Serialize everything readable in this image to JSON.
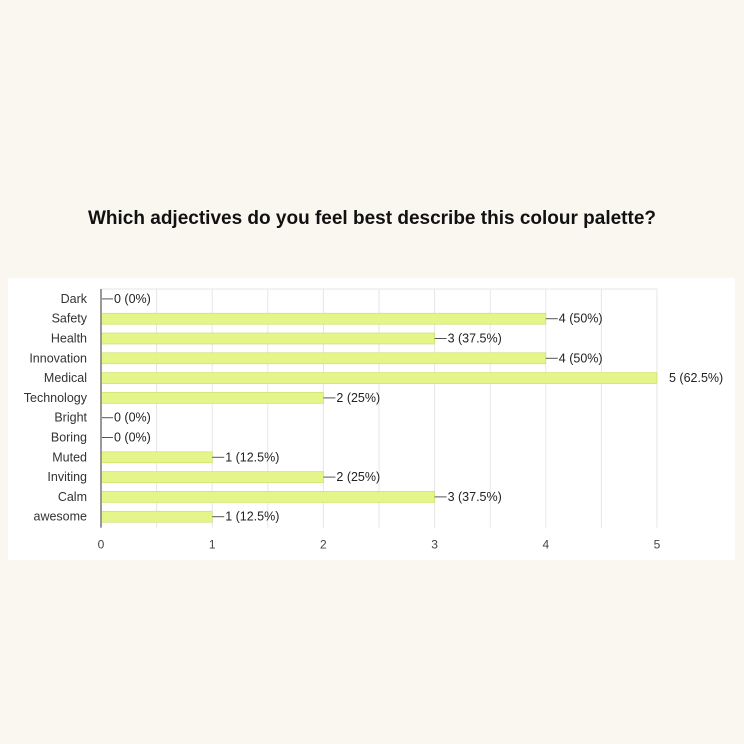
{
  "page": {
    "title": "Which adjectives do you feel best describe this colour palette?"
  },
  "colors": {
    "background": "#faf7f0",
    "bar": "#e5f58a",
    "bar_stroke": "#c9dc5f",
    "grid": "#e6e6e6",
    "axis": "#999999"
  },
  "chart_data": {
    "type": "bar",
    "orientation": "horizontal",
    "categories": [
      "Dark",
      "Safety",
      "Health",
      "Innovation",
      "Medical",
      "Technology",
      "Bright",
      "Boring",
      "Muted",
      "Inviting",
      "Calm",
      "awesome"
    ],
    "values": [
      0,
      4,
      3,
      4,
      5,
      2,
      0,
      0,
      1,
      2,
      3,
      1
    ],
    "data_labels": [
      "0 (0%)",
      "4 (50%)",
      "3 (37.5%)",
      "4 (50%)",
      "5 (62.5%)",
      "2 (25%)",
      "0 (0%)",
      "0 (0%)",
      "1 (12.5%)",
      "2 (25%)",
      "3 (37.5%)",
      "1 (12.5%)"
    ],
    "xlim": [
      0,
      5
    ],
    "xticks": [
      "0",
      "1",
      "2",
      "3",
      "4",
      "5"
    ],
    "grid": true,
    "legend": "none"
  }
}
